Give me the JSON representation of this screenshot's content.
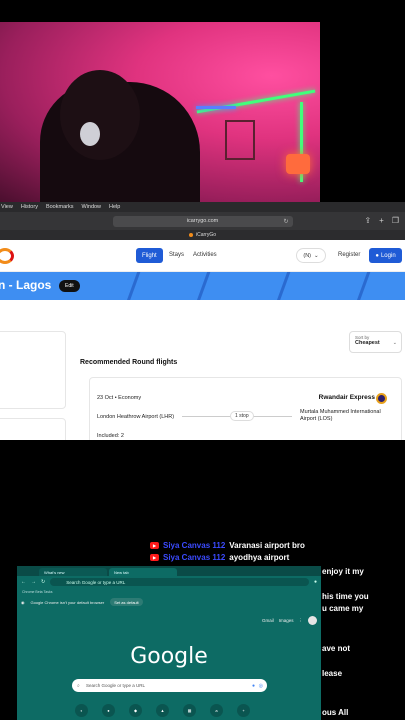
{
  "mac_menu": [
    "View",
    "History",
    "Bookmarks",
    "Window",
    "Help"
  ],
  "safari": {
    "url": "icarrygo.com",
    "tab_title": "iCarryGo"
  },
  "site": {
    "nav": {
      "flight": "Flight",
      "stays": "Stays",
      "activities": "Activities",
      "currency": "(N)",
      "register": "Register",
      "login": "Login"
    },
    "banner_title": "n - Lagos",
    "edit_label": "Edit",
    "sort": {
      "label": "Sort by",
      "value": "Cheapest"
    },
    "recommended_heading": "Recommended Round flights",
    "flight": {
      "date_class": "23 Oct • Economy",
      "airline": "Rwandair Express",
      "from": "London Heathrow Airport (LHR)",
      "stops": "1 stop",
      "to": "Murtala Muhammed International Airport (LOS)",
      "included": "Included: 2"
    }
  },
  "chat": [
    {
      "name": "Siya Canvas 112",
      "message": "Varanasi airport bro"
    },
    {
      "name": "Siya Canvas 112",
      "message": "ayodhya airport"
    }
  ],
  "chat_fragments": [
    "enjoy it my",
    "his time you",
    "u came my",
    "ave not",
    "lease",
    "ous All"
  ],
  "chrome": {
    "tabs": [
      "What's new",
      "New tab"
    ],
    "omnibox": "Search Google or type a URL",
    "bookmarks": "Chrome Beta Tasks",
    "default_msg": "Google Chrome isn't your default browser",
    "default_btn": "Set as default",
    "top_links": [
      "Gmail",
      "Images"
    ],
    "logo": "Google",
    "search_placeholder": "Search Google or type a URL"
  }
}
